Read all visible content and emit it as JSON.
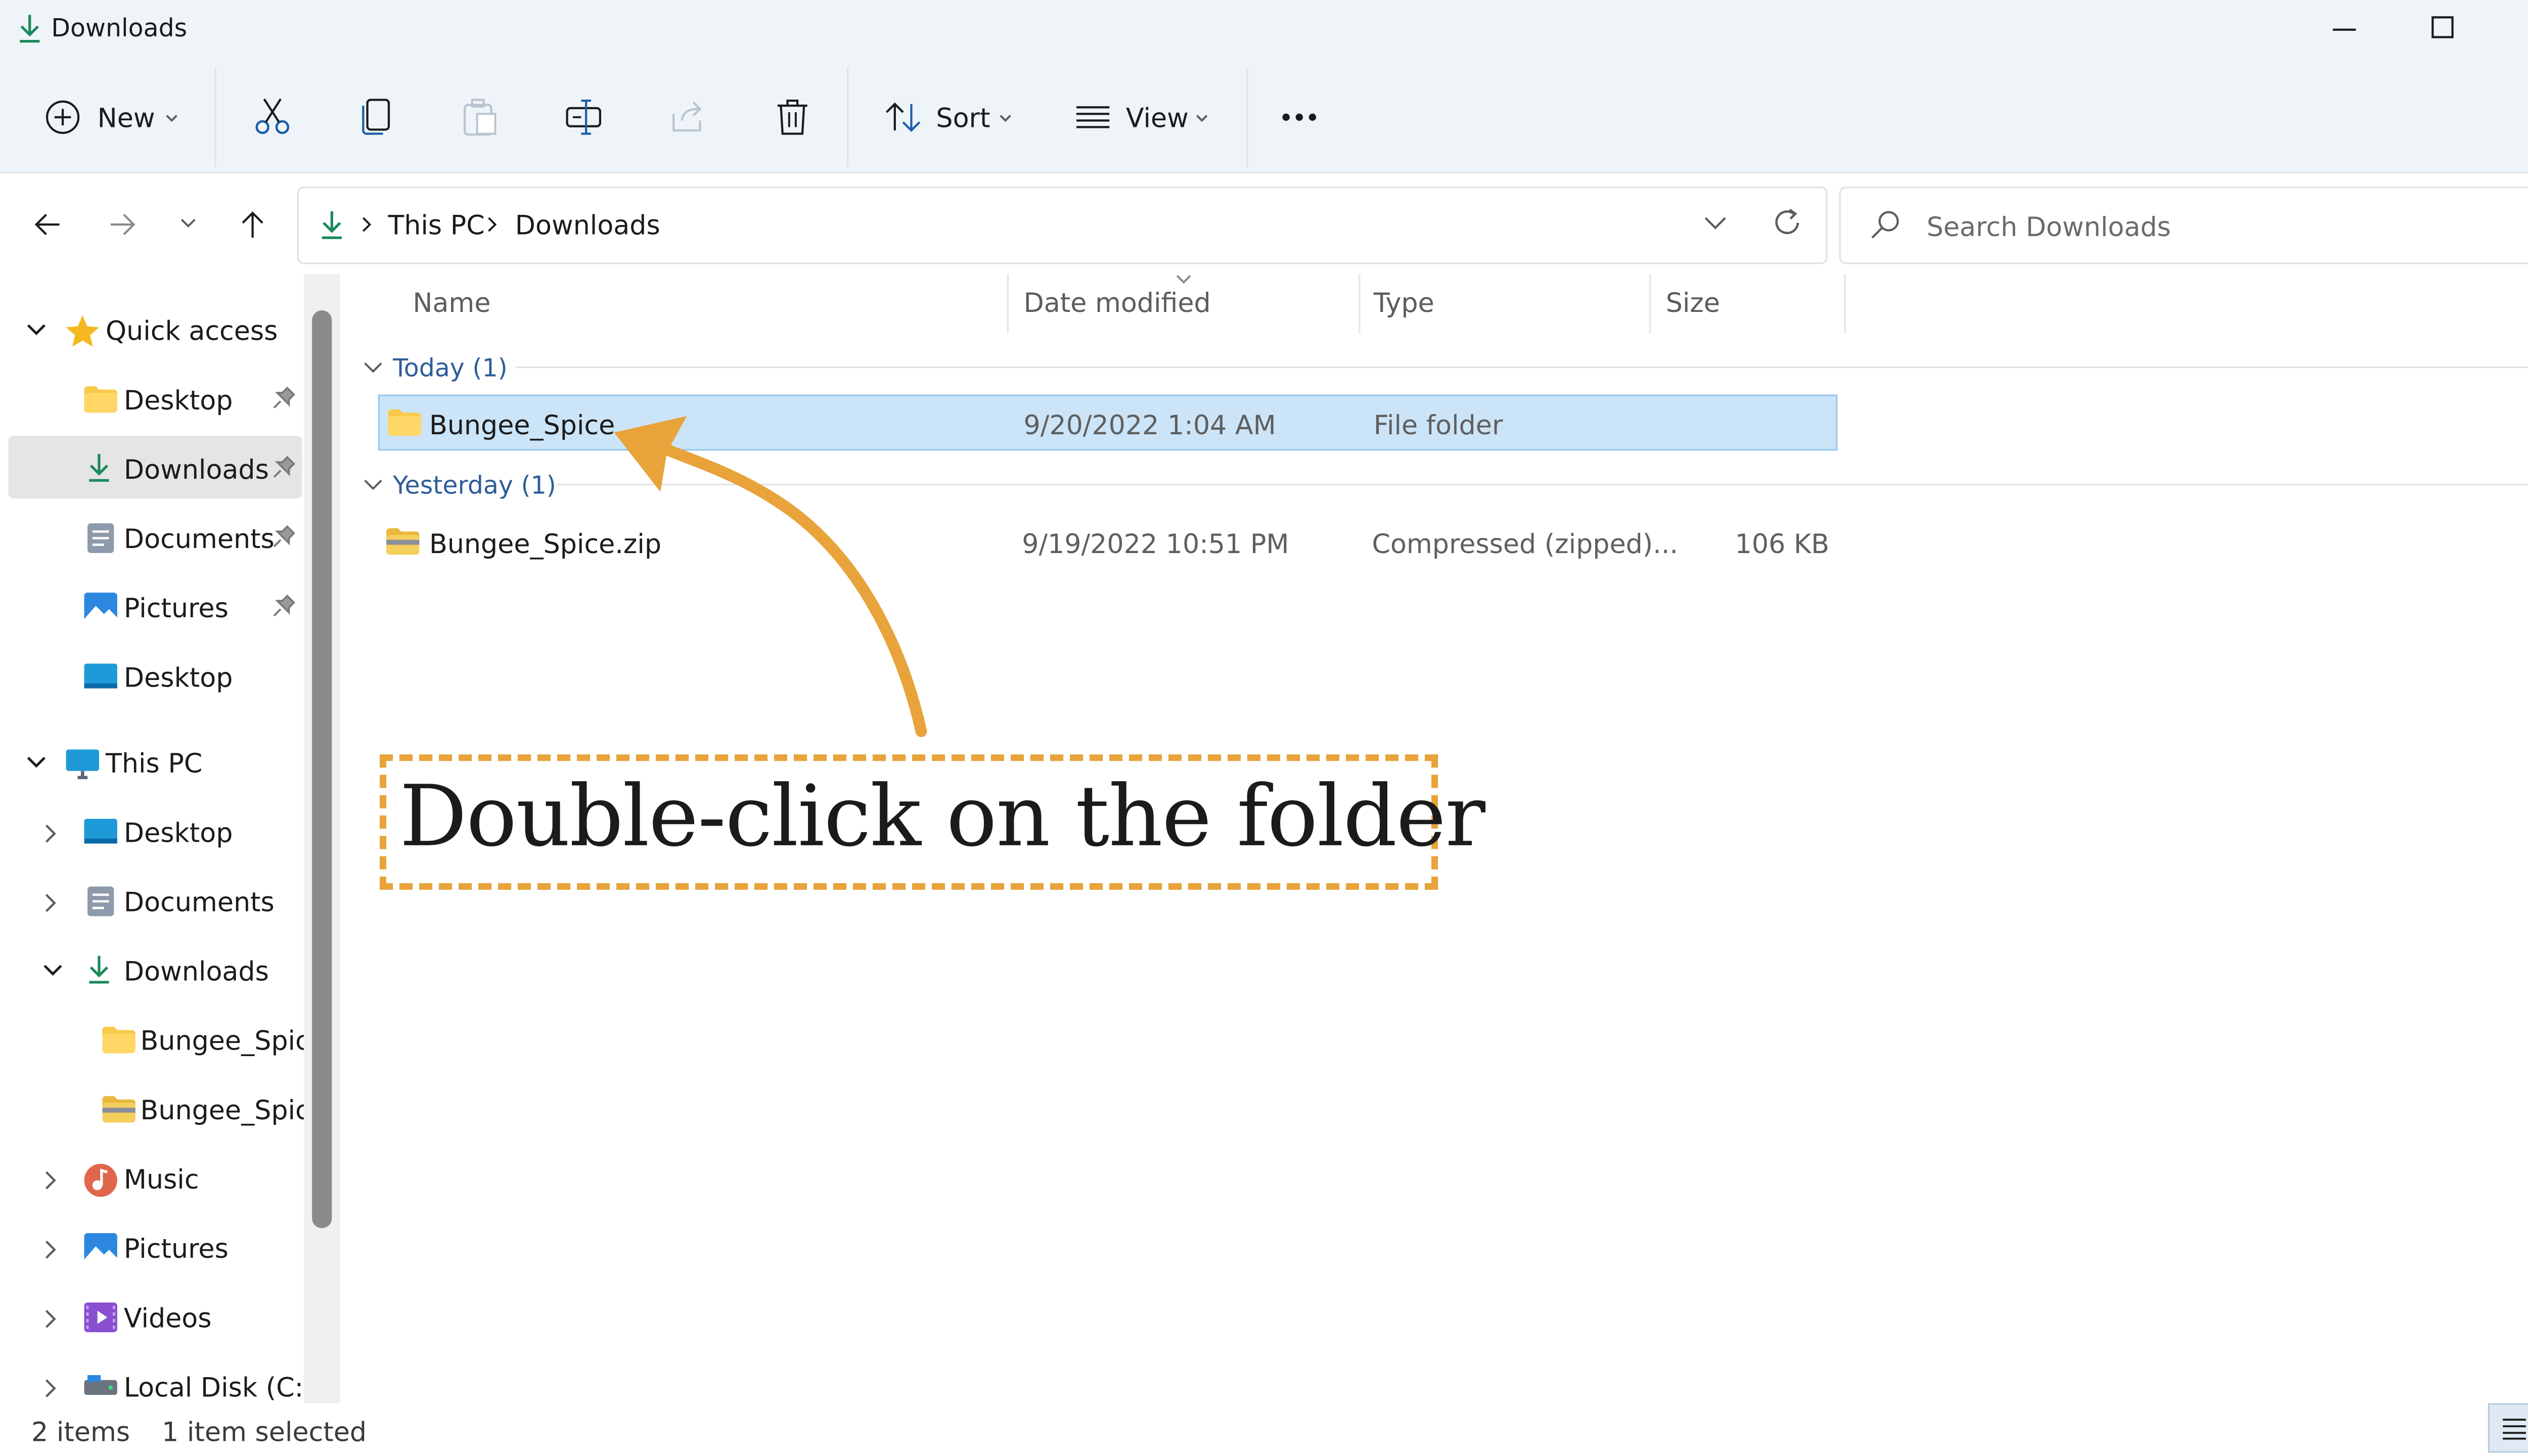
{
  "window": {
    "title": "Downloads"
  },
  "toolbar": {
    "new_label": "New",
    "sort_label": "Sort",
    "view_label": "View"
  },
  "address": {
    "crumbs": [
      "This PC",
      "Downloads"
    ]
  },
  "search": {
    "placeholder": "Search Downloads"
  },
  "sidebar": {
    "quick_access": "Quick access",
    "quick_items": [
      {
        "label": "Desktop",
        "icon": "folder-yellow-icon",
        "pinned": true
      },
      {
        "label": "Downloads",
        "icon": "download-arrow-icon",
        "pinned": true,
        "selected": true
      },
      {
        "label": "Documents",
        "icon": "documents-icon",
        "pinned": true
      },
      {
        "label": "Pictures",
        "icon": "pictures-icon",
        "pinned": true
      },
      {
        "label": "Desktop",
        "icon": "desktop-blue-icon",
        "pinned": false
      }
    ],
    "this_pc": "This PC",
    "pc_items": [
      {
        "label": "Desktop",
        "icon": "desktop-blue-icon"
      },
      {
        "label": "Documents",
        "icon": "documents-icon"
      },
      {
        "label": "Downloads",
        "icon": "download-arrow-icon",
        "expanded": true
      },
      {
        "label": "Bungee_Spice",
        "icon": "folder-yellow-icon"
      },
      {
        "label": "Bungee_Spice",
        "icon": "zip-folder-icon"
      },
      {
        "label": "Music",
        "icon": "music-icon"
      },
      {
        "label": "Pictures",
        "icon": "pictures-icon"
      },
      {
        "label": "Videos",
        "icon": "videos-icon"
      },
      {
        "label": "Local Disk (C:)",
        "icon": "disk-icon"
      }
    ]
  },
  "columns": {
    "name": "Name",
    "date": "Date modified",
    "type": "Type",
    "size": "Size"
  },
  "groups": [
    {
      "label": "Today (1)",
      "rows": [
        {
          "name": "Bungee_Spice",
          "date": "9/20/2022 1:04 AM",
          "type": "File folder",
          "size": "",
          "selected": true
        }
      ]
    },
    {
      "label": "Yesterday (1)",
      "rows": [
        {
          "name": "Bungee_Spice.zip",
          "date": "9/19/2022 10:51 PM",
          "type": "Compressed (zipped)...",
          "size": "106 KB",
          "selected": false
        }
      ]
    }
  ],
  "annotation": {
    "text": "Double-click on the folder",
    "color": "#e8a33a"
  },
  "status": {
    "items": "2 items",
    "selected": "1 item selected"
  },
  "colors": {
    "accent": "#0f7b6c",
    "selection": "#cce4f7",
    "chrome": "#eff4f9"
  }
}
